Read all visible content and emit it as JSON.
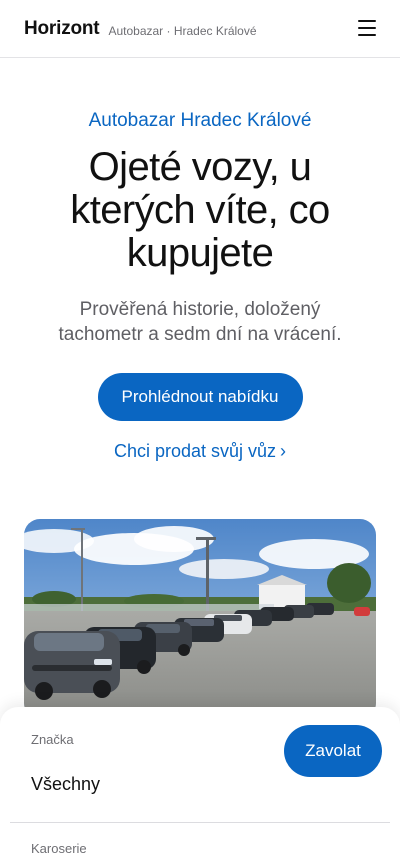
{
  "header": {
    "brand": "Horizont",
    "subtitle": "Autobazar · Hradec Králové",
    "menu_icon": "hamburger-menu-icon"
  },
  "hero": {
    "eyebrow": "Autobazar Hradec Králové",
    "headline": "Ojeté vozy, u kterých víte, co kupujete",
    "lede": "Prověřená historie, doložený tachometr a sedm dní na vrácení.",
    "primary_cta": "Prohlédnout nabídku",
    "secondary_link": "Chci prodat svůj vůz",
    "secondary_link_icon": "chevron-right-icon"
  },
  "image": {
    "subject": "car-lot-photo"
  },
  "filter_sheet": {
    "brand_label": "Značka",
    "brand_value": "Všechny",
    "body_label": "Karoserie",
    "call_button": "Zavolat"
  },
  "colors": {
    "accent": "#0a66c2",
    "text": "#111111",
    "muted": "#6e6e73"
  }
}
